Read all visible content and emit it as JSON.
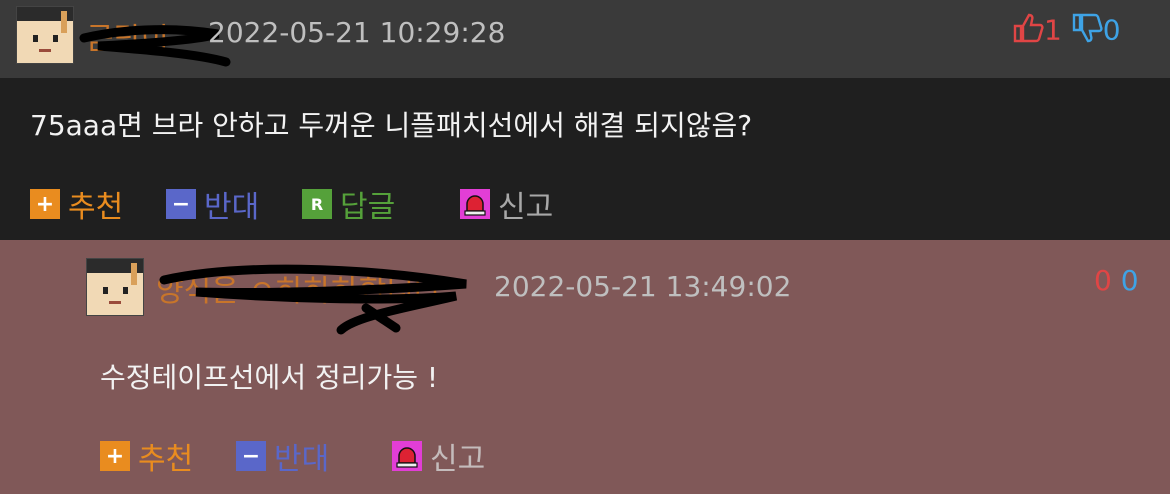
{
  "comments": [
    {
      "username": "곰탐이",
      "date": "2022-05-21 10:29:28",
      "text": "75aaa면 브라 안하고 두꺼운 니플패치선에서 해결 되지않음?",
      "upvotes": "1",
      "downvotes": "0",
      "actions": {
        "recommend": "추천",
        "oppose": "반대",
        "reply": "답글",
        "reply_icon": "R",
        "report": "신고"
      }
    },
    {
      "username": "양식을 ㅇ하하하합니다",
      "date": "2022-05-21 13:49:02",
      "text": "수정테이프선에서 정리가능 !",
      "upvotes": "0",
      "downvotes": "0",
      "actions": {
        "recommend": "추천",
        "oppose": "반대",
        "report": "신고"
      }
    }
  ],
  "colors": {
    "accent_orange": "#e98c1f",
    "oppose_blue": "#5a67c9",
    "reply_green": "#55a13a",
    "report_pink": "#e23ed6",
    "upvote_red": "#e04545",
    "downvote_blue": "#3ea3e6"
  },
  "icons": {
    "plus": "plus-icon",
    "minus": "minus-icon",
    "reply": "reply-icon",
    "report": "siren-icon",
    "thumb_up": "thumbs-up-icon",
    "thumb_down": "thumbs-down-icon"
  }
}
